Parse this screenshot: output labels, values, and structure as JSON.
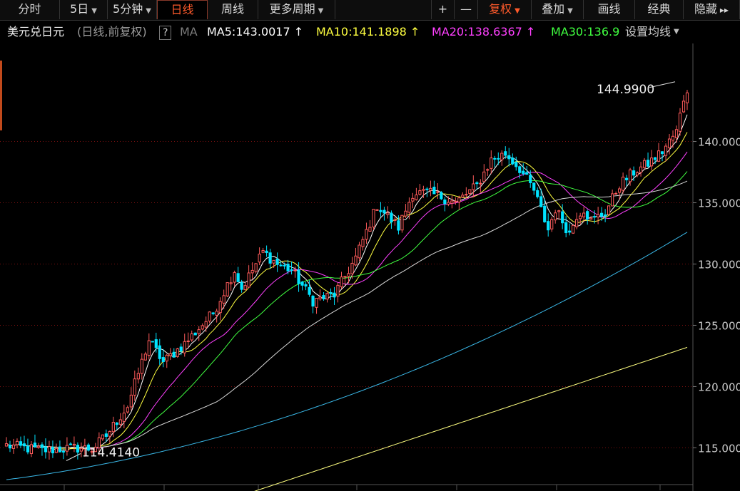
{
  "toolbar": {
    "left_items": [
      "分时",
      "5日",
      "5分钟",
      "日线",
      "周线",
      "更多周期"
    ],
    "active_item": "日线",
    "right_items": [
      "+",
      "—",
      "复权",
      "叠加",
      "画线",
      "经典",
      "隐藏"
    ],
    "fuquan_label": "复权"
  },
  "legend": {
    "symbol": "美元兑日元",
    "sub": "(日线,前复权)",
    "help": "?",
    "ma_label": "MA",
    "ma5": "MA5:143.0017",
    "ma10": "MA10:141.1898",
    "ma20": "MA20:138.6367",
    "ma30": "MA30:136.9",
    "settings": "设置均线"
  },
  "colors": {
    "up": "#ff5b5b",
    "down": "#00e3ff",
    "ma5": "#ffffff",
    "ma10": "#ffff40",
    "ma20": "#ff40ff",
    "ma30": "#40ff40",
    "ma60": "#d8d8d8",
    "ma120": "#3ab8e8",
    "ma250": "#ffff80",
    "grid": "#7a1010",
    "axis_text": "#cccccc"
  },
  "chart_data": {
    "type": "candlestick",
    "y_axis_ticks": [
      "115.000",
      "120.000",
      "125.000",
      "130.000",
      "135.000",
      "140.000"
    ],
    "ylim": [
      112.0,
      148.0
    ],
    "annotations": [
      {
        "label": "144.9900",
        "value": 144.99,
        "kind": "high"
      },
      {
        "label": "114.4140",
        "value": 114.414,
        "kind": "low"
      }
    ],
    "anchors": [
      [
        0,
        115.2
      ],
      [
        10,
        114.8
      ],
      [
        20,
        115.0
      ],
      [
        24,
        114.9
      ],
      [
        28,
        116.0
      ],
      [
        34,
        118.4
      ],
      [
        40,
        123.8
      ],
      [
        44,
        122.0
      ],
      [
        50,
        123.5
      ],
      [
        58,
        126.0
      ],
      [
        64,
        129.5
      ],
      [
        66,
        128.0
      ],
      [
        72,
        131.0
      ],
      [
        76,
        130.0
      ],
      [
        80,
        129.5
      ],
      [
        86,
        127.0
      ],
      [
        92,
        127.5
      ],
      [
        98,
        130.5
      ],
      [
        104,
        134.8
      ],
      [
        110,
        133.0
      ],
      [
        114,
        135.8
      ],
      [
        118,
        135.8
      ],
      [
        122,
        135.5
      ],
      [
        126,
        135.0
      ],
      [
        132,
        136.4
      ],
      [
        136,
        138.5
      ],
      [
        140,
        139.0
      ],
      [
        144,
        137.8
      ],
      [
        148,
        136.0
      ],
      [
        152,
        132.8
      ],
      [
        154,
        134.5
      ],
      [
        158,
        132.5
      ],
      [
        160,
        134.0
      ],
      [
        162,
        134.5
      ],
      [
        164,
        133.5
      ],
      [
        168,
        134.2
      ],
      [
        172,
        136.5
      ],
      [
        176,
        137.5
      ],
      [
        180,
        138.2
      ],
      [
        184,
        139.2
      ],
      [
        188,
        140.8
      ],
      [
        190,
        143.5
      ],
      [
        191,
        144.3
      ]
    ],
    "moving_averages": [
      {
        "name": "MA5",
        "color": "#ffffff",
        "start": [
          0,
          115.0
        ],
        "end": [
          191,
          143.0
        ]
      },
      {
        "name": "MA10",
        "color": "#ffff40",
        "start": [
          0,
          115.0
        ],
        "end": [
          191,
          141.19
        ]
      },
      {
        "name": "MA20",
        "color": "#ff40ff",
        "start": [
          0,
          114.9
        ],
        "end": [
          191,
          138.64
        ]
      },
      {
        "name": "MA30",
        "color": "#40ff40",
        "start": [
          0,
          114.8
        ],
        "end": [
          191,
          136.9
        ]
      },
      {
        "name": "MA60",
        "color": "#d8d8d8",
        "start": [
          0,
          114.6
        ],
        "end": [
          191,
          135.5
        ]
      },
      {
        "name": "MA120",
        "color": "#3ab8e8",
        "start": [
          0,
          112.4
        ],
        "end": [
          191,
          132.6
        ]
      },
      {
        "name": "MA250",
        "color": "#ffff80",
        "start": [
          68,
          111.3
        ],
        "end": [
          191,
          123.2
        ]
      }
    ]
  }
}
